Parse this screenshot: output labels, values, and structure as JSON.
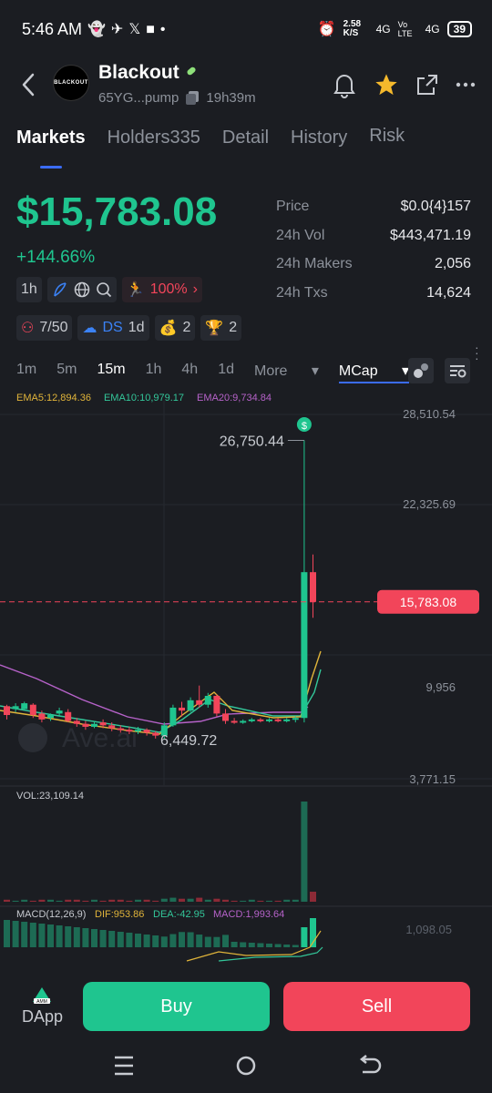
{
  "status": {
    "time": "5:46 AM",
    "speed": "2.58 K/S",
    "net1": "4G",
    "net2": "Vo LTE",
    "net3": "4G",
    "battery": "39"
  },
  "header": {
    "title": "Blackout",
    "address": "65YG...pump",
    "age": "19h39m",
    "avatar_text": "BLACKOUT"
  },
  "tabs": [
    {
      "label": "Markets"
    },
    {
      "label": "Holders335"
    },
    {
      "label": "Detail"
    },
    {
      "label": "History"
    },
    {
      "label": "Risk"
    }
  ],
  "price": {
    "big": "$15,783.08",
    "change": "+144.66%"
  },
  "stats": [
    {
      "k": "Price",
      "v": "$0.0{4}157"
    },
    {
      "k": "24h Vol",
      "v": "$443,471.19"
    },
    {
      "k": "24h Makers",
      "v": "2,056"
    },
    {
      "k": "24h Txs",
      "v": "14,624"
    }
  ],
  "chips": {
    "interval": "1h",
    "percent": "100%",
    "holders": "7/50",
    "ds": "DS",
    "ds_period": "1d",
    "bags": "2",
    "trophy": "2"
  },
  "intervals": [
    "1m",
    "5m",
    "15m",
    "1h",
    "4h",
    "1d",
    "More",
    "MCap"
  ],
  "ema": {
    "ema5": "EMA5:12,894.36",
    "ema10": "EMA10:10,979.17",
    "ema20": "EMA20:9,734.84"
  },
  "chart_data": {
    "type": "candlestick",
    "y_axis_labels": [
      "28,510.54",
      "22,325.69",
      "9,956",
      "3,771.15"
    ],
    "current_price_label": "15,783.08",
    "high_label": "26,750.44",
    "low_label": "6,449.72",
    "vol_label": "VOL:23,109.14",
    "macd": {
      "label": "MACD(12,26,9)",
      "dif": "DIF:953.86",
      "dea": "DEA:-42.95",
      "macd": "MACD:1,993.64",
      "axis": "1,098.05"
    },
    "candles": [
      {
        "o": 8700,
        "h": 8800,
        "l": 7800,
        "c": 8100
      },
      {
        "o": 8500,
        "h": 8900,
        "l": 8300,
        "c": 8700
      },
      {
        "o": 8500,
        "h": 9000,
        "l": 8400,
        "c": 8900
      },
      {
        "o": 8800,
        "h": 8900,
        "l": 7900,
        "c": 8100
      },
      {
        "o": 8200,
        "h": 8400,
        "l": 7600,
        "c": 7800
      },
      {
        "o": 7900,
        "h": 8200,
        "l": 7700,
        "c": 8100
      },
      {
        "o": 8200,
        "h": 8600,
        "l": 8000,
        "c": 8400
      },
      {
        "o": 8300,
        "h": 8500,
        "l": 7600,
        "c": 7700
      },
      {
        "o": 7700,
        "h": 7900,
        "l": 7300,
        "c": 7500
      },
      {
        "o": 7500,
        "h": 7700,
        "l": 7100,
        "c": 7300
      },
      {
        "o": 7300,
        "h": 7700,
        "l": 7200,
        "c": 7500
      },
      {
        "o": 7600,
        "h": 7800,
        "l": 7200,
        "c": 7400
      },
      {
        "o": 7400,
        "h": 7600,
        "l": 7000,
        "c": 7200
      },
      {
        "o": 7200,
        "h": 7400,
        "l": 6900,
        "c": 7100
      },
      {
        "o": 7100,
        "h": 7300,
        "l": 6800,
        "c": 7000
      },
      {
        "o": 7000,
        "h": 7300,
        "l": 6800,
        "c": 7100
      },
      {
        "o": 7100,
        "h": 7200,
        "l": 6700,
        "c": 6900
      },
      {
        "o": 6900,
        "h": 7000,
        "l": 6500,
        "c": 6700
      },
      {
        "o": 6700,
        "h": 7600,
        "l": 6449,
        "c": 7400
      },
      {
        "o": 7400,
        "h": 8800,
        "l": 7300,
        "c": 8600
      },
      {
        "o": 8600,
        "h": 9000,
        "l": 8000,
        "c": 8400
      },
      {
        "o": 8400,
        "h": 9300,
        "l": 8300,
        "c": 9100
      },
      {
        "o": 9100,
        "h": 10100,
        "l": 8600,
        "c": 8800
      },
      {
        "o": 8800,
        "h": 9600,
        "l": 8600,
        "c": 9400
      },
      {
        "o": 9400,
        "h": 9500,
        "l": 8000,
        "c": 8200
      },
      {
        "o": 8200,
        "h": 8500,
        "l": 7500,
        "c": 7700
      },
      {
        "o": 7700,
        "h": 7900,
        "l": 7500,
        "c": 7600
      },
      {
        "o": 7600,
        "h": 7800,
        "l": 7500,
        "c": 7700
      },
      {
        "o": 7700,
        "h": 7900,
        "l": 7600,
        "c": 7800
      },
      {
        "o": 7800,
        "h": 7900,
        "l": 7600,
        "c": 7700
      },
      {
        "o": 7700,
        "h": 7900,
        "l": 7600,
        "c": 7800
      },
      {
        "o": 7800,
        "h": 7900,
        "l": 7600,
        "c": 7700
      },
      {
        "o": 7700,
        "h": 7900,
        "l": 7600,
        "c": 7800
      },
      {
        "o": 7800,
        "h": 8000,
        "l": 7600,
        "c": 7900
      },
      {
        "o": 7900,
        "h": 26750.44,
        "l": 7600,
        "c": 17800
      },
      {
        "o": 17800,
        "h": 19000,
        "l": 14700,
        "c": 15783.08
      }
    ],
    "volumes": [
      0.02,
      0.01,
      0.02,
      0.01,
      0.02,
      0.02,
      0.01,
      0.02,
      0.02,
      0.01,
      0.02,
      0.01,
      0.02,
      0.02,
      0.01,
      0.02,
      0.02,
      0.01,
      0.03,
      0.04,
      0.03,
      0.03,
      0.04,
      0.02,
      0.03,
      0.02,
      0.01,
      0.01,
      0.02,
      0.01,
      0.01,
      0.01,
      0.02,
      0.02,
      1.0,
      0.1
    ]
  },
  "bottom": {
    "dapp": "DApp",
    "buy": "Buy",
    "sell": "Sell"
  }
}
